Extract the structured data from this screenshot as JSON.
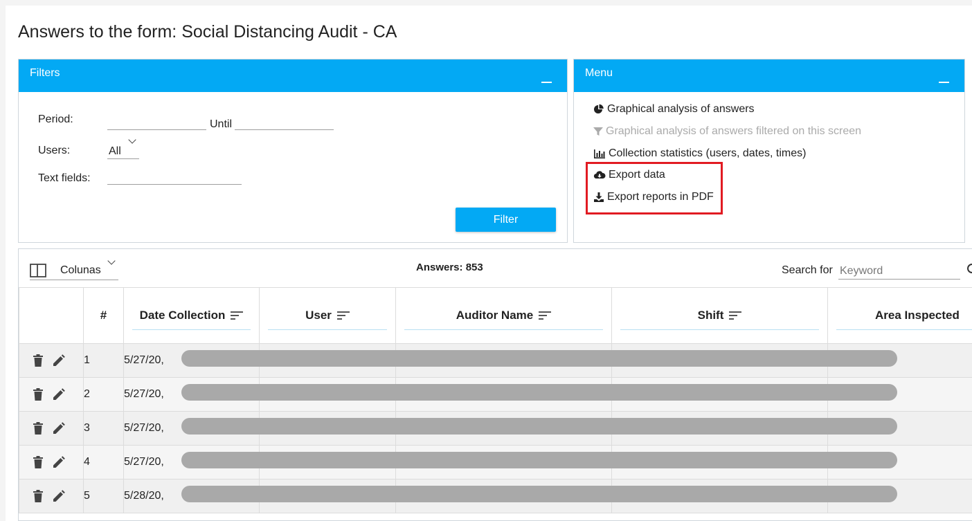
{
  "page": {
    "title": "Answers to the form: Social Distancing Audit - CA"
  },
  "filters": {
    "header": "Filters",
    "period_label": "Period:",
    "until_label": "Until",
    "period_from": "",
    "period_until": "",
    "users_label": "Users:",
    "users_value": "All",
    "text_fields_label": "Text fields:",
    "text_fields_value": "",
    "filter_button": "Filter"
  },
  "menu": {
    "header": "Menu",
    "items": [
      {
        "label": "Graphical analysis of answers",
        "icon": "pie-chart-icon",
        "enabled": true
      },
      {
        "label": "Graphical analysis of answers filtered on this screen",
        "icon": "filter-icon",
        "enabled": false
      },
      {
        "label": "Collection statistics (users, dates, times)",
        "icon": "bar-chart-icon",
        "enabled": true
      },
      {
        "label": "Export data",
        "icon": "cloud-download-icon",
        "enabled": true
      },
      {
        "label": "Export reports in PDF",
        "icon": "download-icon",
        "enabled": true
      }
    ],
    "highlight_color": "#e11b22"
  },
  "table": {
    "columns_label": "Colunas",
    "answers_count": "Answers: 853",
    "search_label": "Search for",
    "search_placeholder": "Keyword",
    "headers": [
      "#",
      "Date Collection",
      "User",
      "Auditor Name",
      "Shift",
      "Area Inspected"
    ],
    "rows": [
      {
        "num": "1",
        "date": "5/27/20,"
      },
      {
        "num": "2",
        "date": "5/27/20,"
      },
      {
        "num": "3",
        "date": "5/27/20,"
      },
      {
        "num": "4",
        "date": "5/27/20,"
      },
      {
        "num": "5",
        "date": "5/28/20,"
      }
    ]
  },
  "colors": {
    "accent": "#03a9f4",
    "redaction": "#a9a9a9"
  }
}
